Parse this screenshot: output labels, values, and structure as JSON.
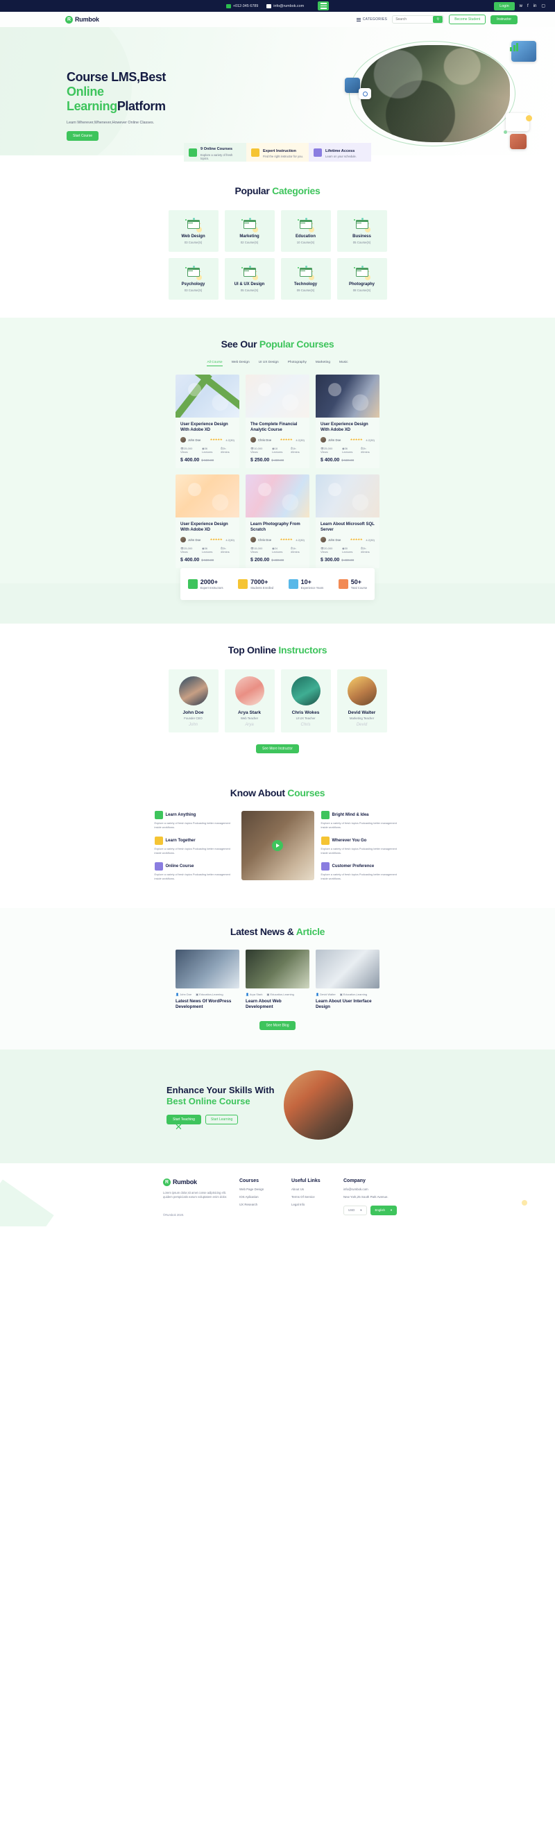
{
  "topbar": {
    "phone": "+012-345 6789",
    "email": "info@rumbok.com",
    "login": "Login",
    "socials": [
      "twitter-icon",
      "facebook-icon",
      "linkedin-icon",
      "instagram-icon"
    ]
  },
  "nav": {
    "brand": "Rumbok",
    "brand_initial": "R",
    "categories_label": "CATEGORIES",
    "search_placeholder": "Search",
    "become_student": "Become Student",
    "instructor": "Instructor"
  },
  "hero": {
    "title_line1": "Course LMS,Best",
    "title_line2_green": "Online",
    "title_line3_green": "Learning",
    "title_line3_dark": "Platform",
    "subtitle": "Learn Wherever,Whenever,However Online Classes.",
    "cta": "Start Course"
  },
  "features": [
    {
      "title": "9 Online Courses",
      "sub": "Explore a variety of fresh topics.",
      "icon": "book-icon"
    },
    {
      "title": "Expert Instruction",
      "sub": "Find the right instructor for you.",
      "icon": "hexagon-icon"
    },
    {
      "title": "Lifetime Access",
      "sub": "Learn on your schedule.",
      "icon": "infinity-icon"
    }
  ],
  "categories_section": {
    "head_dark": "Popular ",
    "head_green": "Categories",
    "items": [
      {
        "name": "Web Design",
        "count": "03 Course(S)"
      },
      {
        "name": "Marketing",
        "count": "02 Course(S)"
      },
      {
        "name": "Education",
        "count": "10 Course(S)"
      },
      {
        "name": "Business",
        "count": "05 Course(S)"
      },
      {
        "name": "Psychology",
        "count": "03 Course(S)"
      },
      {
        "name": "UI & UX Design",
        "count": "05 Course(S)"
      },
      {
        "name": "Technology",
        "count": "09 Course(S)"
      },
      {
        "name": "Photography",
        "count": "08 Course(S)"
      }
    ]
  },
  "courses_section": {
    "head_dark": "See Our ",
    "head_green": "Popular Courses",
    "tabs": [
      "All Course",
      "Web Design",
      "UI UX Design",
      "Photography",
      "Marketing",
      "Music"
    ],
    "active_tab": "All Course",
    "cards": [
      {
        "title": "User Experience Design With Adobe XD",
        "instructor": "John Doe",
        "stars": "★★★★★",
        "rating": "4.2(30)",
        "views": "25,000 Views",
        "lectures": "36 Lectures",
        "duration": "2h 40mins",
        "price": "$ 400.00",
        "old_price": "$ 500.00"
      },
      {
        "title": "The Complete Financial Analytic Course",
        "instructor": "Chris Doe",
        "stars": "★★★★★",
        "rating": "4.2(30)",
        "views": "10,000 Views",
        "lectures": "18 Lectures",
        "duration": "1h 40mins",
        "price": "$ 250.00",
        "old_price": "$ 400.00"
      },
      {
        "title": "User Experience Design With Adobe XD",
        "instructor": "John Doe",
        "stars": "★★★★★",
        "rating": "4.2(30)",
        "views": "25,000 Views",
        "lectures": "36 Lectures",
        "duration": "2h 40mins",
        "price": "$ 400.00",
        "old_price": "$ 500.00"
      },
      {
        "title": "User Experience Design With Adobe XD",
        "instructor": "John Doe",
        "stars": "★★★★★",
        "rating": "4.2(30)",
        "views": "25,000 Views",
        "lectures": "36 Lectures",
        "duration": "2h 40mins",
        "price": "$ 400.00",
        "old_price": "$ 500.00"
      },
      {
        "title": "Learn Photography From Scratch",
        "instructor": "Chris Doe",
        "stars": "★★★★★",
        "rating": "4.2(30)",
        "views": "15,000 Views",
        "lectures": "24 Lectures",
        "duration": "1h 40mins",
        "price": "$ 200.00",
        "old_price": "$ 400.00"
      },
      {
        "title": "Learn About Microsoft SQL Server",
        "instructor": "John Doe",
        "stars": "★★★★★",
        "rating": "4.2(30)",
        "views": "20,000 Views",
        "lectures": "30 Lectures",
        "duration": "2h 40mins",
        "price": "$ 300.00",
        "old_price": "$ 400.00"
      }
    ]
  },
  "stats": [
    {
      "number": "2000+",
      "label": "Expert Instructors",
      "icon": "instructor-icon"
    },
    {
      "number": "7000+",
      "label": "Students Enrolled",
      "icon": "students-icon"
    },
    {
      "number": "10+",
      "label": "Experience Years",
      "icon": "experience-icon"
    },
    {
      "number": "50+",
      "label": "Total Course",
      "icon": "course-icon"
    }
  ],
  "instructors_section": {
    "head_dark": "Top Online ",
    "head_green": "Instructors",
    "button": "See More Instructor",
    "items": [
      {
        "name": "John Doe",
        "role": "Founder CEO",
        "sign": "John"
      },
      {
        "name": "Arya Stark",
        "role": "Web Teacher",
        "sign": "Arya"
      },
      {
        "name": "Chris Wokes",
        "role": "UI UX Teacher",
        "sign": "Chris"
      },
      {
        "name": "Devid Walter",
        "role": "Marketing Teacher",
        "sign": "Devid"
      }
    ]
  },
  "know_section": {
    "head_dark": "Know About ",
    "head_green": "Courses",
    "left": [
      {
        "title": "Learn Anything",
        "text": "Explore a variety of fresh topics Podcasting better management inside workflows."
      },
      {
        "title": "Learn Together",
        "text": "Explore a variety of fresh topics Podcasting better management inside workflows."
      },
      {
        "title": "Online Course",
        "text": "Explore a variety of fresh topics Podcasting better management inside workflows."
      }
    ],
    "right": [
      {
        "title": "Bright Mind & Idea",
        "text": "Explore a variety of fresh topics Podcasting better management inside workflows."
      },
      {
        "title": "Wherever You Go",
        "text": "Explore a variety of fresh topics Podcasting better management inside workflows."
      },
      {
        "title": "Customer Preference",
        "text": "Explore a variety of fresh topics Podcasting better management inside workflows."
      }
    ]
  },
  "news_section": {
    "head_dark": "Latest News & ",
    "head_green": "Article",
    "button": "See More Blog",
    "items": [
      {
        "author": "John Doe",
        "category": "Education,Learning",
        "title": "Latest News Of WordPress Development"
      },
      {
        "author": "Arya Stark",
        "category": "Education,Learning",
        "title": "Learn About Web Development"
      },
      {
        "author": "Devid Walter",
        "category": "Education,Learning",
        "title": "Learn About User Interface Design"
      }
    ]
  },
  "cta": {
    "line1": "Enhance Your Skills With",
    "line2": "Best Online Course",
    "primary": "Start Teaching",
    "secondary": "Start Learning"
  },
  "footer": {
    "brand": "Rumbok",
    "brand_initial": "R",
    "description": "Lorem ipsum dolor,sit amet conse adipisicing elit. quidem perspiciatis earum voluptatem enim dolor.",
    "copyright": "©Rumbok 2020.",
    "columns": [
      {
        "head": "Courses",
        "links": [
          "Web Page Design",
          "IOS Aplication",
          "UX Research"
        ]
      },
      {
        "head": "Useful Links",
        "links": [
          "About Us",
          "Terms Of Service",
          "Legal Info"
        ]
      },
      {
        "head": "Company",
        "links": [
          "info@rumbok.com",
          "New York,25 South Park Avenue."
        ]
      }
    ],
    "currency": "USD",
    "language": "English"
  },
  "colors": {
    "accent": "#3ec45c",
    "dark": "#141b42",
    "light_green": "#eaf7ee",
    "yellow": "#f5c433",
    "purple": "#8a7de0"
  }
}
